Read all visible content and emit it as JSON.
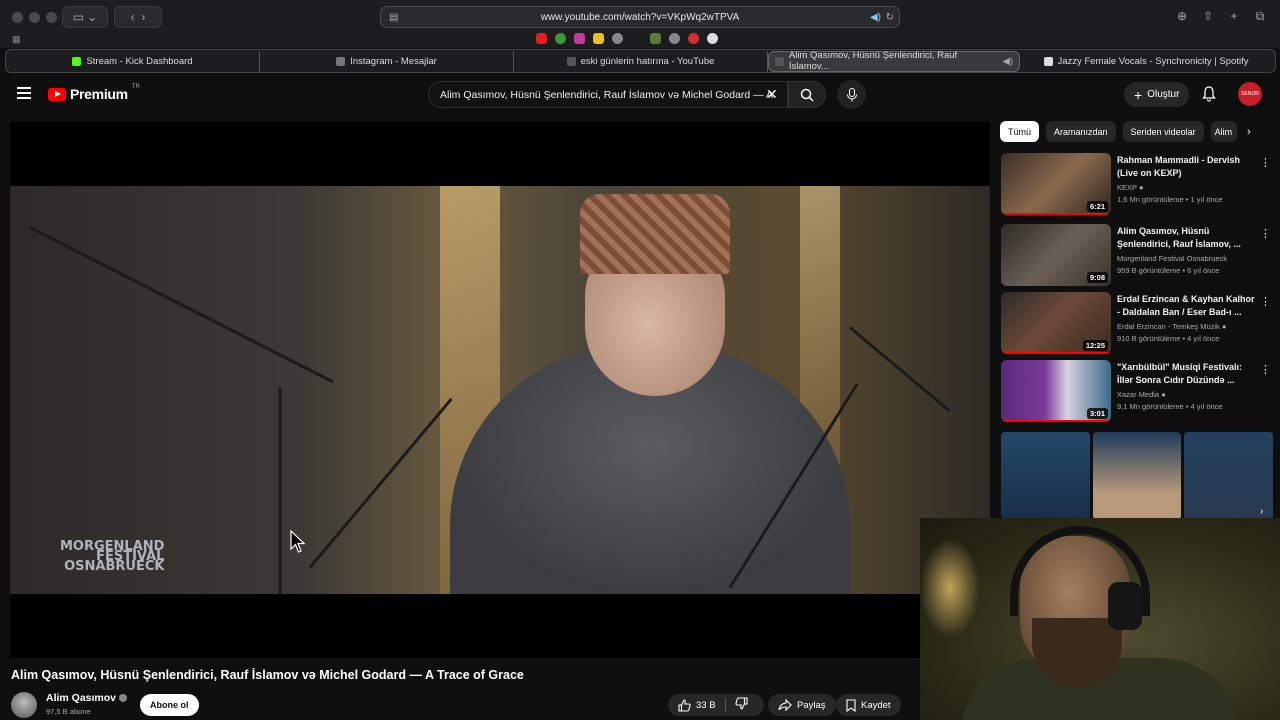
{
  "browser": {
    "url": "www.youtube.com/watch?v=VKpWq2wTPVA",
    "tabs": [
      {
        "label": "Stream - Kick Dashboard",
        "active": false
      },
      {
        "label": "Instagram - Mesajlar",
        "active": false
      },
      {
        "label": "eski günlerin hatırına - YouTube",
        "active": false
      },
      {
        "label": "Alim Qasımov, Hüsnü Şenlendirici, Rauf İslamov...",
        "active": true
      },
      {
        "label": "Jazzy Female Vocals - Synchronicity | Spotify",
        "active": false
      }
    ]
  },
  "header": {
    "logo_text": "Premium",
    "logo_super": "TR",
    "search_value": "Alim Qasımov, Hüsnü Şenlendirici, Rauf İslamov və Michel Godard — A",
    "create_label": "Oluştur",
    "avatar_text": "SENOR"
  },
  "video": {
    "watermark_lines": [
      "MORGENLAND",
      "FESTIVAL",
      "OSNABRUECK"
    ],
    "title": "Alim Qasımov, Hüsnü Şenlendirici, Rauf İslamov və Michel Godard — A Trace of Grace",
    "channel": "Alim Qasımov",
    "subscribers": "97,5 B abone",
    "subscribe_label": "Abone ol",
    "likes": "33 B",
    "share_label": "Paylaş",
    "save_label": "Kaydet"
  },
  "sidebar": {
    "chips": [
      "Tümü",
      "Aramanızdan",
      "Seriden videolar",
      "Alim"
    ],
    "recommendations": [
      {
        "title": "Rahman Mammadli - Dervish (Live on KEXP)",
        "channel": "KEXP",
        "meta": "1,6 Mn görüntüleme • 1 yıl önce",
        "duration": "6:21",
        "progress": 100
      },
      {
        "title": "Alim Qasımov, Hüsnü Şenlendirici, Rauf İslamov, ...",
        "channel": "Morgenland Festival Osnabrueck",
        "meta": "959 B görüntüleme • 6 yıl önce",
        "duration": "9:08",
        "progress": 0
      },
      {
        "title": "Erdal Erzincan & Kayhan Kalhor - Daldalan Ban / Eser Bad-ı ...",
        "channel": "Erdal Erzincan - Temkeş Müzik",
        "meta": "910 B görüntüleme • 4 yıl önce",
        "duration": "12:25",
        "progress": 100
      },
      {
        "title": "\"Xarıbülbül\" Musiqi Festivalı: İllər Sonra Cıdır Düzündə ...",
        "channel": "Xazar Media",
        "meta": "9,1 Mn görüntüleme • 4 yıl önce",
        "duration": "3:01",
        "progress": 100
      }
    ]
  }
}
